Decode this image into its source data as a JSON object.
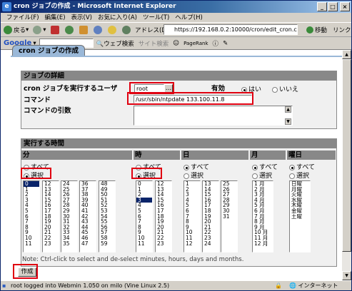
{
  "window": {
    "title": "cron ジョブの作成 - Microsoft Internet Explorer"
  },
  "menu": [
    "ファイル(F)",
    "編集(E)",
    "表示(V)",
    "お気に入り(A)",
    "ツール(T)",
    "ヘルプ(H)"
  ],
  "toolbar": {
    "back": "戻る",
    "address_label": "アドレス(D)",
    "address": "https://192.168.0.2:10000/cron/edit_cron.cgi?new=1",
    "go": "移動",
    "links": "リンク"
  },
  "googlebar": {
    "logo": "Google",
    "web_search": "ウェブ検索",
    "site_search": "サイト検索",
    "pagerank": "PageRank"
  },
  "page": {
    "tab_title": "cron ジョブの作成",
    "details": {
      "header": "ジョブの詳細",
      "user_label": "cron ジョブを実行するユーザ",
      "user_value": "root",
      "active_label": "有効",
      "yes": "はい",
      "no": "いいえ",
      "active_value": "yes",
      "command_label": "コマンド",
      "command_value": "/usr/sbin/ntpdate 133.100.11.8",
      "input_label": "コマンドの引数",
      "input_value": ""
    },
    "schedule": {
      "header": "実行する時間",
      "columns": [
        {
          "name": "分",
          "all": "すべて",
          "selected": "選択",
          "mode": "selected"
        },
        {
          "name": "時",
          "all": "すべて",
          "selected": "選択",
          "mode": "selected"
        },
        {
          "name": "日",
          "all": "すべて",
          "selected": "選択",
          "mode": "all"
        },
        {
          "name": "月",
          "all": "すべて",
          "selected": "選択",
          "mode": "all"
        },
        {
          "name": "曜日",
          "all": "すべて",
          "selected": "選択",
          "mode": "all"
        }
      ],
      "minute_lists": [
        [
          "0",
          "1",
          "2",
          "3",
          "4",
          "5",
          "6",
          "7",
          "8",
          "9",
          "10",
          "11"
        ],
        [
          "12",
          "13",
          "14",
          "15",
          "16",
          "17",
          "18",
          "19",
          "20",
          "21",
          "22",
          "23"
        ],
        [
          "24",
          "25",
          "26",
          "27",
          "28",
          "29",
          "30",
          "31",
          "32",
          "33",
          "34",
          "35"
        ],
        [
          "36",
          "37",
          "38",
          "39",
          "40",
          "41",
          "42",
          "43",
          "44",
          "45",
          "46",
          "47"
        ],
        [
          "48",
          "49",
          "50",
          "51",
          "52",
          "53",
          "54",
          "55",
          "56",
          "57",
          "58",
          "59"
        ]
      ],
      "minute_selected": "0",
      "hour_lists": [
        [
          "0",
          "1",
          "2",
          "3",
          "4",
          "5",
          "6",
          "7",
          "8",
          "9",
          "10",
          "11"
        ],
        [
          "12",
          "13",
          "14",
          "15",
          "16",
          "17",
          "18",
          "19",
          "20",
          "21",
          "22",
          "23"
        ]
      ],
      "hour_selected": "3",
      "day_lists": [
        [
          "1",
          "2",
          "3",
          "4",
          "5",
          "6",
          "7",
          "8",
          "9",
          "10",
          "11",
          "12"
        ],
        [
          "13",
          "14",
          "15",
          "16",
          "17",
          "18",
          "19",
          "20",
          "21",
          "22",
          "23",
          "24"
        ],
        [
          "25",
          "26",
          "27",
          "28",
          "29",
          "30",
          "31"
        ]
      ],
      "month_list": [
        "1 月",
        "2 月",
        "3 月",
        "4 月",
        "5 月",
        "6 月",
        "7 月",
        "8 月",
        "9 月",
        "10 月",
        "11 月",
        "12 月"
      ],
      "weekday_list": [
        "日曜",
        "月曜",
        "火曜",
        "水曜",
        "木曜",
        "金曜",
        "土曜"
      ],
      "note": "Note: Ctrl-click to select and de-select minutes, hours, days and months."
    },
    "create_button": "作成"
  },
  "status": {
    "text": "root logged into Webmin 1.050 on milo (Vine Linux 2.5)",
    "zone": "インターネット"
  }
}
